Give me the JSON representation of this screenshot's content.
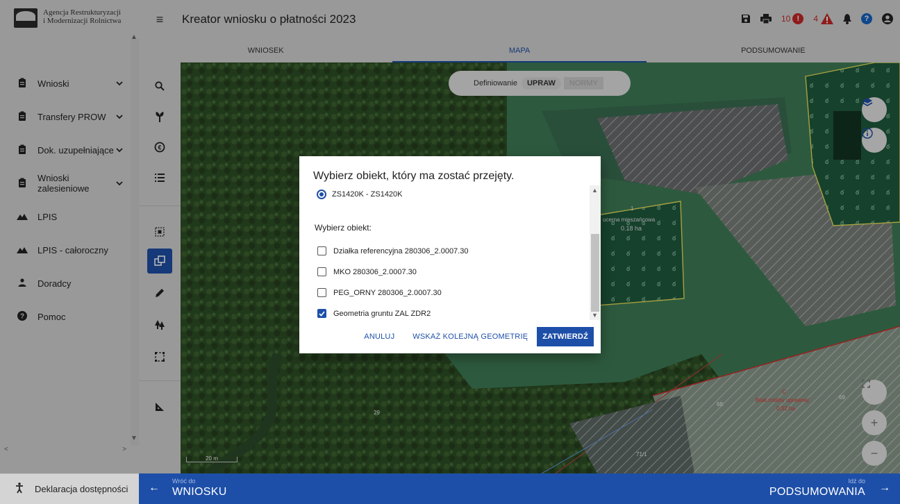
{
  "brand": {
    "line1": "Agencja Restrukturyzacji",
    "line2": "i Modernizacji Rolnictwa"
  },
  "app": {
    "title": "Kreator wniosku o płatności 2023"
  },
  "header": {
    "errors_count": "10",
    "warnings_count": "4"
  },
  "tabs": [
    {
      "label": "WNIOSEK"
    },
    {
      "label": "MAPA"
    },
    {
      "label": "PODSUMOWANIE"
    }
  ],
  "sidebar": {
    "items": [
      {
        "label": "Wnioski"
      },
      {
        "label": "Transfery PROW"
      },
      {
        "label": "Dok. uzupełniające"
      },
      {
        "label": "Wnioski zalesieniowe"
      },
      {
        "label": "LPIS"
      },
      {
        "label": "LPIS - całoroczny"
      },
      {
        "label": "Doradcy"
      },
      {
        "label": "Pomoc"
      }
    ],
    "footer": "Deklaracja dostępności"
  },
  "map": {
    "mode_label": "Definiowanie",
    "mode_active": "UPRAW",
    "mode_inactive": "NORMY",
    "scale": "20 m",
    "labels": {
      "crop_left": "ucerna mieszańcowa",
      "area_left": "0.18 ha",
      "parcel_a": "29",
      "parcel_b": "71/1",
      "parcel_c": "68",
      "parcel_d": "69",
      "crop_right_letter": "C",
      "crop_right": "Brak rośliny uprawnej",
      "area_right": "0.32 ha",
      "parcel_top": "1"
    }
  },
  "dialog": {
    "title": "Wybierz obiekt, który ma zostać przejęty.",
    "radio_option": "ZS1420K - ZS1420K",
    "section_label": "Wybierz obiekt:",
    "options": [
      {
        "label": "Działka referencyjna 280306_2.0007.30",
        "checked": false
      },
      {
        "label": "MKO 280306_2.0007.30",
        "checked": false
      },
      {
        "label": "PEG_ORNY 280306_2.0007.30",
        "checked": false
      },
      {
        "label": "Geometria gruntu ZAL ZDR2",
        "checked": true
      }
    ],
    "actions": {
      "cancel": "ANULUJ",
      "next": "WSKAŻ KOLEJNĄ GEOMETRIĘ",
      "confirm": "ZATWIERDŹ"
    }
  },
  "bottom": {
    "back_small": "Wróć do",
    "back_big": "WNIOSKU",
    "next_small": "Idź do",
    "next_big": "PODSUMOWANIA"
  },
  "colors": {
    "accent": "#1e4fa8",
    "error": "#c62828",
    "chrome": "#d4d4d4"
  }
}
